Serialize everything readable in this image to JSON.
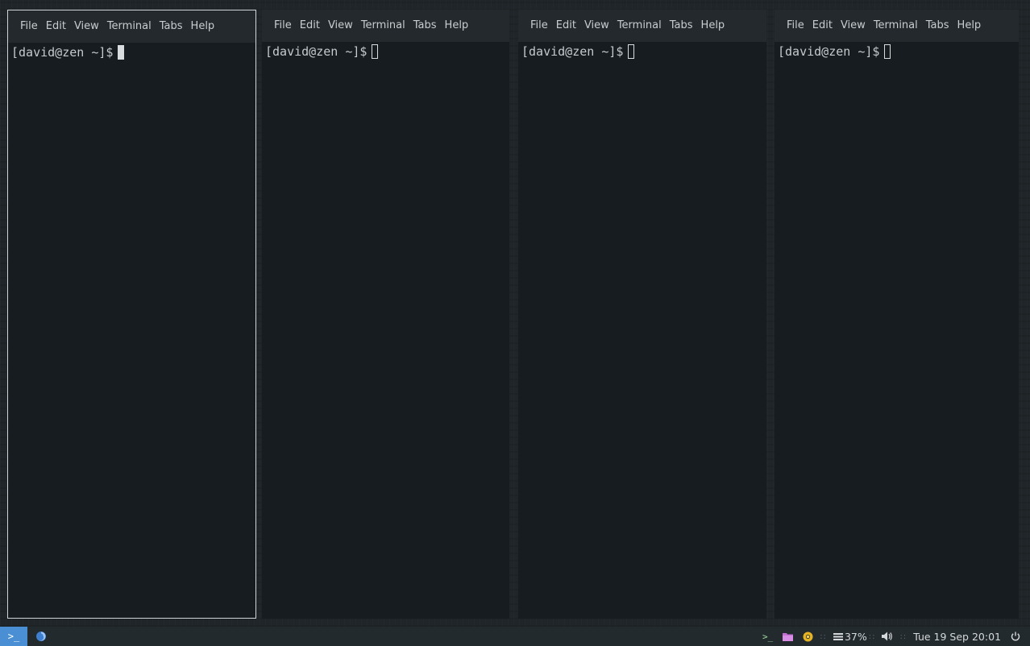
{
  "menu": [
    "File",
    "Edit",
    "View",
    "Terminal",
    "Tabs",
    "Help"
  ],
  "terminals": [
    {
      "prompt": "[david@zen ~]$",
      "focused": true
    },
    {
      "prompt": "[david@zen ~]$",
      "focused": false
    },
    {
      "prompt": "[david@zen ~]$",
      "focused": false
    },
    {
      "prompt": "[david@zen ~]$",
      "focused": false
    }
  ],
  "taskbar": {
    "start_glyph": ">_",
    "tray_terminal_glyph": ">_",
    "battery": "37%",
    "clock": "Tue 19 Sep 20:01"
  },
  "colors": {
    "start_button": "#4a8fd4",
    "terminal_bg": "#161c1f",
    "menubar_bg": "#23292c"
  },
  "icons": [
    "start-terminal-icon",
    "firefox-icon",
    "terminal-icon",
    "folder-icon",
    "chromium-icon",
    "battery-icon",
    "volume-icon",
    "power-icon"
  ]
}
